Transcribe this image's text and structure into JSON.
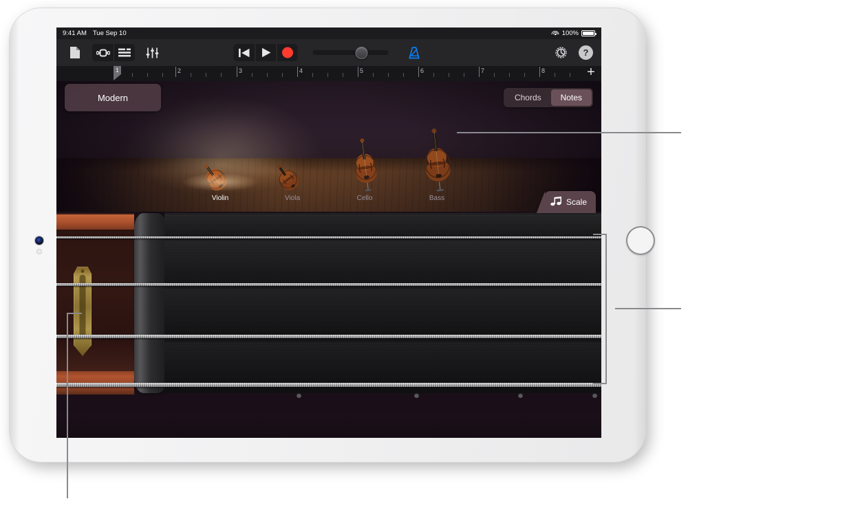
{
  "device": {
    "name": "iPad"
  },
  "status_bar": {
    "time": "9:41 AM",
    "date": "Tue Sep 10",
    "battery_percent": "100%",
    "wifi_icon": "wifi-icon",
    "battery_icon": "battery-icon"
  },
  "toolbar": {
    "left_buttons": [
      {
        "name": "document-icon",
        "label": "My Songs"
      },
      {
        "name": "loop-browser-icon",
        "label": "Loop Browser"
      },
      {
        "name": "tracks-view-icon",
        "label": "Tracks View"
      },
      {
        "name": "mixer-icon",
        "label": "Track Controls"
      }
    ],
    "transport": [
      {
        "name": "rewind-icon",
        "label": "Rewind"
      },
      {
        "name": "play-icon",
        "label": "Play"
      },
      {
        "name": "record-icon",
        "label": "Record"
      }
    ],
    "volume": {
      "name": "master-volume-slider",
      "value": 56
    },
    "metronome": {
      "name": "metronome-icon",
      "label": "Metronome",
      "color": "#0a84ff",
      "active": true
    },
    "settings": {
      "name": "settings-gear-icon",
      "label": "Settings"
    },
    "help": {
      "name": "help-button",
      "label": "?"
    }
  },
  "ruler": {
    "bars": [
      "1",
      "2",
      "3",
      "4",
      "5",
      "6",
      "7",
      "8"
    ],
    "playhead_bar": "1",
    "add_button_label": "+"
  },
  "stage": {
    "preset_name": "Modern",
    "mode_toggle": {
      "options": [
        "Chords",
        "Notes"
      ],
      "selected": "Notes"
    },
    "instruments": [
      {
        "label": "Violin",
        "selected": true
      },
      {
        "label": "Viola",
        "selected": false
      },
      {
        "label": "Cello",
        "selected": false
      },
      {
        "label": "Bass",
        "selected": false
      }
    ],
    "scale_button": {
      "label": "Scale",
      "icon": "double-eighth-note-icon"
    }
  },
  "fretboard": {
    "strings": [
      {
        "index": 1,
        "thickness": 3
      },
      {
        "index": 2,
        "thickness": 4
      },
      {
        "index": 3,
        "thickness": 5
      },
      {
        "index": 4,
        "thickness": 6
      }
    ],
    "position_markers": 4
  },
  "callouts": [
    {
      "name": "callout-instrument-selector"
    },
    {
      "name": "callout-strings-bracket"
    },
    {
      "name": "callout-tailpiece"
    }
  ],
  "colors": {
    "accent_blue": "#0a84ff",
    "record_red": "#ff3b30",
    "stage_purple": "#2b1d2a",
    "pill_mauve": "#4e3a42",
    "wood_brown": "#6d4628",
    "callout_gray": "#8a8a8e"
  }
}
